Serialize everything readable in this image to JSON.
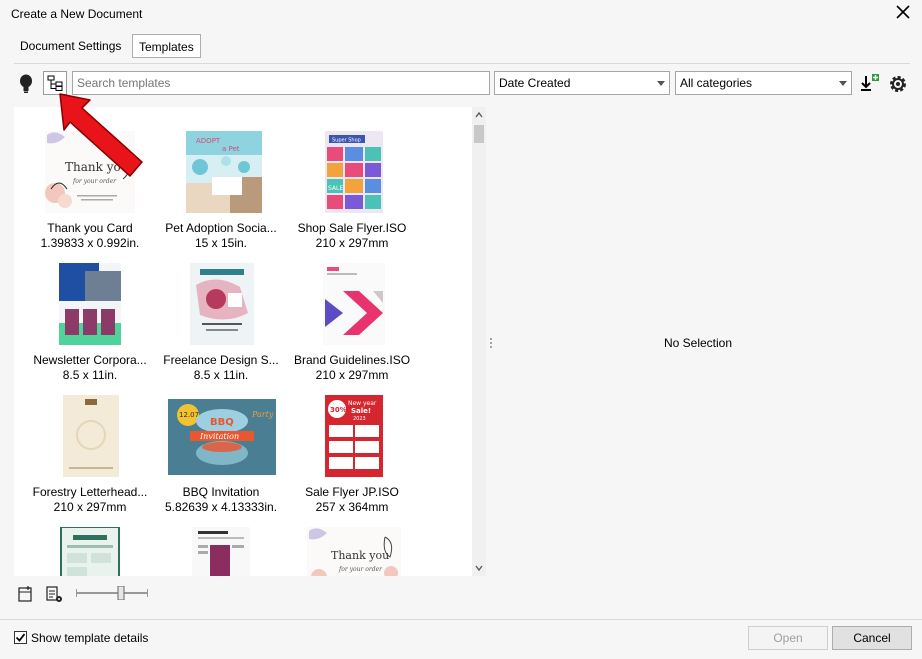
{
  "window": {
    "title": "Create a New Document"
  },
  "tabs": [
    {
      "label": "Document Settings"
    },
    {
      "label": "Templates"
    }
  ],
  "toolbar": {
    "search_placeholder": "Search templates",
    "sort_value": "Date Created",
    "category_value": "All categories"
  },
  "templates": [
    {
      "name": "Thank you Card",
      "size": "1.39833 x 0.992in."
    },
    {
      "name": "Pet Adoption Socia...",
      "size": "15 x 15in."
    },
    {
      "name": "Shop Sale Flyer.ISO",
      "size": "210 x 297mm"
    },
    {
      "name": "Newsletter Corpora...",
      "size": "8.5 x 11in."
    },
    {
      "name": "Freelance Design S...",
      "size": "8.5 x 11in."
    },
    {
      "name": "Brand Guidelines.ISO",
      "size": "210 x 297mm"
    },
    {
      "name": "Forestry Letterhead...",
      "size": "210 x 297mm"
    },
    {
      "name": "BBQ Invitation",
      "size": "5.82639 x 4.13333in."
    },
    {
      "name": "Sale Flyer JP.ISO",
      "size": "257 x 364mm"
    }
  ],
  "thumb_text": {
    "thank_you": "Thank you",
    "for_your_order": "for your order",
    "pet_line1": "ADOPT",
    "pet_line2": "a Pet",
    "super_shop": "Super Shop",
    "sale": "SALE",
    "bbq": "BBQ",
    "invitation": "Invitation",
    "party": "Party",
    "bbq_date": "12.07",
    "new_year": "New year",
    "new_year_sale": "Sale!",
    "new_year_year": "2023",
    "pct": "30%"
  },
  "details": {
    "no_selection": "No Selection"
  },
  "footer": {
    "show_details_label": "Show template details",
    "show_details_checked": true,
    "open_label": "Open",
    "cancel_label": "Cancel"
  }
}
